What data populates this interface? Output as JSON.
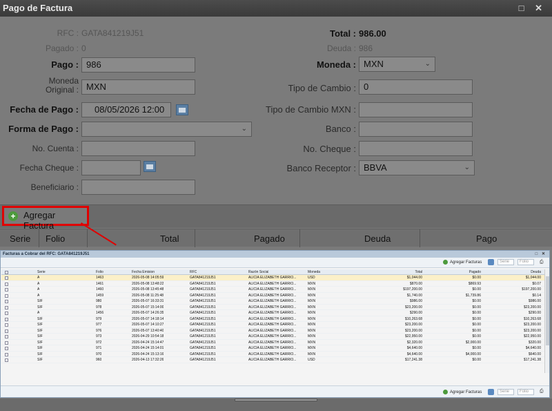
{
  "window": {
    "title": "Pago de Factura",
    "controls": "□ ✕"
  },
  "form": {
    "rfc_label": "RFC :",
    "rfc_value": "GATA841219J51",
    "pagado_label": "Pagado :",
    "pagado_value": "0",
    "pago_label": "Pago :",
    "pago_value": "986",
    "moneda_original_label_1": "Moneda",
    "moneda_original_label_2": "Original :",
    "moneda_original_value": "MXN",
    "fecha_pago_label": "Fecha de Pago :",
    "fecha_pago_value": "08/05/2026 12:00",
    "forma_pago_label": "Forma de Pago :",
    "forma_pago_value": "",
    "no_cuenta_label": "No. Cuenta :",
    "no_cuenta_value": "",
    "fecha_cheque_label": "Fecha Cheque :",
    "fecha_cheque_value": "",
    "beneficiario_label": "Beneficiario :",
    "beneficiario_value": "",
    "total_label": "Total :",
    "total_value": "986.00",
    "deuda_label": "Deuda :",
    "deuda_value": "986",
    "moneda_label": "Moneda :",
    "moneda_value": "MXN",
    "tipo_cambio_label": "Tipo de Cambio :",
    "tipo_cambio_value": "0",
    "tipo_cambio_mxn_label": "Tipo de Cambio MXN :",
    "tipo_cambio_mxn_value": "",
    "banco_label": "Banco :",
    "banco_value": "",
    "no_cheque_label": "No. Cheque :",
    "no_cheque_value": "",
    "banco_receptor_label": "Banco Receptor :",
    "banco_receptor_value": "BBVA"
  },
  "toolbar": {
    "agregar_label": "Agregar Factura"
  },
  "grid": {
    "columns": [
      "Serie",
      "Folio",
      "Total",
      "Pagado",
      "Deuda",
      "Pago"
    ]
  },
  "dialog": {
    "title": "Facturas a Cobrar del RFC: GATA841219J51",
    "controls": "□ ✕",
    "agregar_label": "Agregar Facturas",
    "serie_placeholder": "Serie",
    "folio_placeholder": "Folio",
    "columns": [
      "Serie",
      "Folio",
      "Fecha Emision",
      "RFC",
      "Razón Social",
      "Moneda",
      "Total",
      "Pagado",
      "Deuda"
    ],
    "rows": [
      {
        "serie": "A",
        "folio": "1463",
        "fecha": "2026-05-08 14:05:59",
        "rfc": "GATA841219J51",
        "razon": "ALICIA ELIZABETH GARRIO...",
        "moneda": "USD",
        "total": "$1,044.00",
        "pagado": "$0.00",
        "deuda": "$1,044.00",
        "checked": true
      },
      {
        "serie": "A",
        "folio": "1461",
        "fecha": "2026-05-08 13:48:22",
        "rfc": "GATA841219J51",
        "razon": "ALICIA ELIZABETH GARRIO...",
        "moneda": "MXN",
        "total": "$870.00",
        "pagado": "$869.93",
        "deuda": "$0.07",
        "checked": false
      },
      {
        "serie": "A",
        "folio": "1460",
        "fecha": "2026-05-08 13:45:48",
        "rfc": "GATA841219J51",
        "razon": "ALICIA ELIZABETH GARRIO...",
        "moneda": "MXN",
        "total": "$197,200.00",
        "pagado": "$0.00",
        "deuda": "$197,200.00",
        "checked": false
      },
      {
        "serie": "A",
        "folio": "1459",
        "fecha": "2026-05-08 11:25:48",
        "rfc": "GATA841219J51",
        "razon": "ALICIA ELIZABETH GARRIO...",
        "moneda": "MXN",
        "total": "$1,740.00",
        "pagado": "$1,739.86",
        "deuda": "$0.14",
        "checked": false
      },
      {
        "serie": "SIF",
        "folio": "980",
        "fecha": "2026-05-07 16:33:31",
        "rfc": "GATA841219J51",
        "razon": "ALICIA ELIZABETH GARRIO...",
        "moneda": "MXN",
        "total": "$986.00",
        "pagado": "$0.00",
        "deuda": "$986.00",
        "checked": false
      },
      {
        "serie": "SIF",
        "folio": "978",
        "fecha": "2026-05-07 15:14:00",
        "rfc": "GATA841219J51",
        "razon": "ALICIA ELIZABETH GARRIO...",
        "moneda": "MXN",
        "total": "$23,200.00",
        "pagado": "$0.00",
        "deuda": "$23,200.00",
        "checked": false
      },
      {
        "serie": "A",
        "folio": "1456",
        "fecha": "2026-05-07 14:26:35",
        "rfc": "GATA841219J51",
        "razon": "ALICIA ELIZABETH GARRIO...",
        "moneda": "MXN",
        "total": "$290.00",
        "pagado": "$0.00",
        "deuda": "$290.00",
        "checked": false
      },
      {
        "serie": "SIF",
        "folio": "979",
        "fecha": "2026-05-07 14:18:14",
        "rfc": "GATA841219J51",
        "razon": "ALICIA ELIZABETH GARRIO...",
        "moneda": "MXN",
        "total": "$10,263.68",
        "pagado": "$0.00",
        "deuda": "$10,263.68",
        "checked": false
      },
      {
        "serie": "SIF",
        "folio": "977",
        "fecha": "2026-05-07 14:10:27",
        "rfc": "GATA841219J51",
        "razon": "ALICIA ELIZABETH GARRIO...",
        "moneda": "MXN",
        "total": "$23,200.00",
        "pagado": "$0.00",
        "deuda": "$23,200.00",
        "checked": false
      },
      {
        "serie": "SIF",
        "folio": "976",
        "fecha": "2026-05-07 13:40:40",
        "rfc": "GATA841219J51",
        "razon": "ALICIA ELIZABETH GARRIO...",
        "moneda": "MXN",
        "total": "$23,200.00",
        "pagado": "$0.00",
        "deuda": "$23,200.00",
        "checked": false
      },
      {
        "serie": "SIF",
        "folio": "973",
        "fecha": "2026-04-29 10:54:18",
        "rfc": "GATA841219J51",
        "razon": "ALICIA ELIZABETH GARRIO...",
        "moneda": "MXN",
        "total": "$22,950.00",
        "pagado": "$0.00",
        "deuda": "$22,950.00",
        "checked": false
      },
      {
        "serie": "SIF",
        "folio": "972",
        "fecha": "2026-04-24 15:14:47",
        "rfc": "GATA841219J51",
        "razon": "ALICIA ELIZABETH GARRIO...",
        "moneda": "MXN",
        "total": "$2,320.00",
        "pagado": "$2,000.00",
        "deuda": "$320.00",
        "checked": false
      },
      {
        "serie": "SIF",
        "folio": "971",
        "fecha": "2026-04-24 15:14:01",
        "rfc": "GATA841219J51",
        "razon": "ALICIA ELIZABETH GARRIO...",
        "moneda": "MXN",
        "total": "$4,640.00",
        "pagado": "$0.00",
        "deuda": "$4,640.00",
        "checked": false
      },
      {
        "serie": "SIF",
        "folio": "970",
        "fecha": "2026-04-24 15:13:16",
        "rfc": "GATA841219J51",
        "razon": "ALICIA ELIZABETH GARRIO...",
        "moneda": "MXN",
        "total": "$4,640.00",
        "pagado": "$4,000.00",
        "deuda": "$640.00",
        "checked": false
      },
      {
        "serie": "SIF",
        "folio": "960",
        "fecha": "2026-04-13 17:32:26",
        "rfc": "GATA841219J51",
        "razon": "ALICIA ELIZABETH GARRIO...",
        "moneda": "USD",
        "total": "$17,241.38",
        "pagado": "$0.00",
        "deuda": "$17,241.38",
        "checked": false
      }
    ]
  },
  "colors": {
    "highlight": "#e00000",
    "selected_row": "#fbf0c9"
  }
}
